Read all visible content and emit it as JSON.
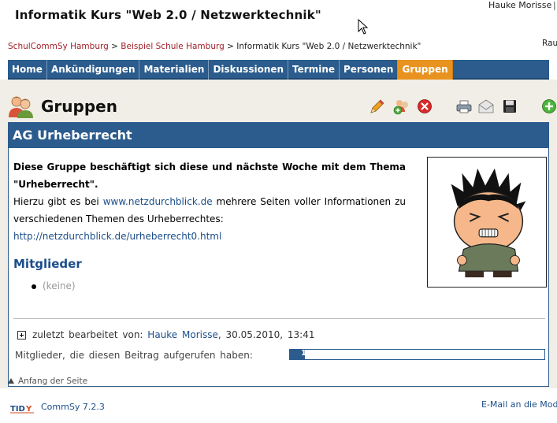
{
  "header": {
    "site_title": "Informatik Kurs \"Web 2.0 / Netzwerktechnik\"",
    "user_name": "Hauke Morisse",
    "user_separator": "|"
  },
  "breadcrumb": {
    "items": [
      "SchulCommSy Hamburg",
      "Beispiel Schule Hamburg",
      "Informatik Kurs \"Web 2.0 / Netzwerktechnik\""
    ],
    "separator": ">",
    "right_text": "Rau"
  },
  "nav": {
    "items": [
      {
        "label": "Home"
      },
      {
        "label": "Ankündigungen"
      },
      {
        "label": "Materialien"
      },
      {
        "label": "Diskussionen"
      },
      {
        "label": "Termine"
      },
      {
        "label": "Personen"
      },
      {
        "label": "Gruppen"
      }
    ],
    "active": "Gruppen"
  },
  "page": {
    "title": "Gruppen",
    "tools": [
      "pencil-edit-icon",
      "add-member-icon",
      "delete-icon",
      "print-icon",
      "email-icon",
      "save-icon",
      "new-item-icon"
    ]
  },
  "group": {
    "name": "AG Urheberrecht",
    "description_bold": "Diese Gruppe beschäftigt sich diese und nächste Woche mit dem Thema \"Urheberrecht\".",
    "description_pre": "Hierzu gibt es bei ",
    "description_link": "www.netzdurchblick.de",
    "description_post": " mehrere Seiten voller Informationen zu verschiedenen Themen des Urheberrechtes:",
    "url": "http://netzdurchblick.de/urheberrecht0.html",
    "members_title": "Mitglieder",
    "members_none": "(keine)",
    "edited_prefix": "zuletzt bearbeitet von:",
    "edited_by": "Hauke Morisse",
    "edited_sep": ",",
    "edited_date": "30.05.2010,",
    "edited_time": "13:41",
    "viewers_label": "Mitglieder, die diesen Beitrag aufgerufen haben:",
    "viewers_count": "1",
    "viewers_fraction": 0.06
  },
  "footer": {
    "back_to_top": "Anfang der Seite",
    "tidy_logo_text": "TIDY",
    "version": "CommSy 7.2.3",
    "email_link": "E-Mail an die Mode"
  },
  "colors": {
    "nav_blue": "#2b5c8d",
    "nav_active": "#e8931f",
    "link_blue": "#1b4d8a",
    "crumb_red": "#a0202a",
    "content_bg": "#f0eee6"
  }
}
